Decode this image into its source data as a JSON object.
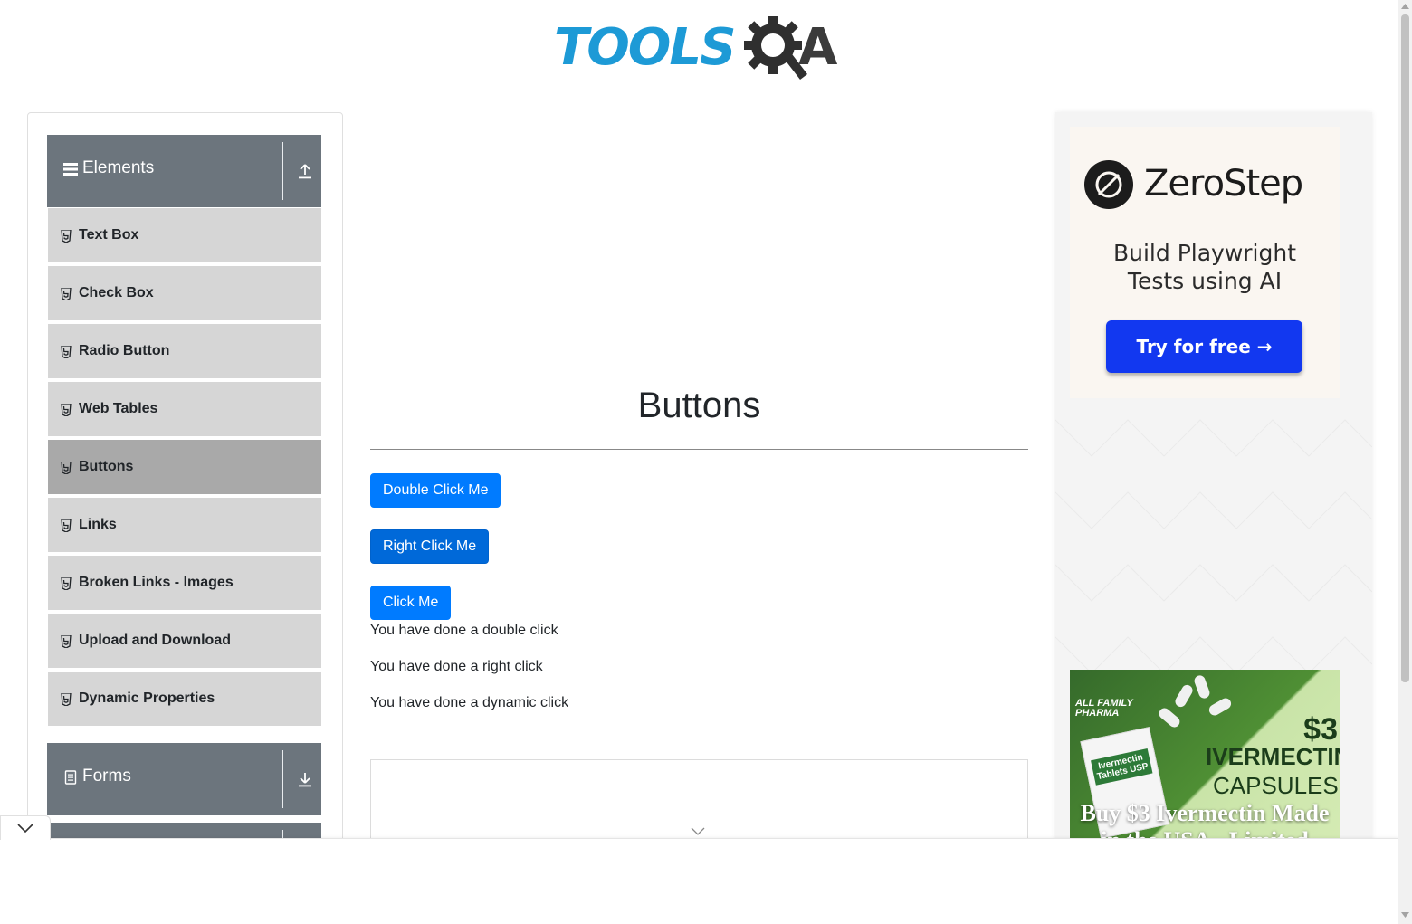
{
  "header": {
    "logo_text": "TOOLS",
    "logo_suffix": "A"
  },
  "sidebar": {
    "groups": [
      {
        "title": "Elements",
        "icon": "hamburger-icon",
        "arrow": "expand-up-icon"
      },
      {
        "title": "Forms",
        "icon": "document-icon",
        "arrow": "expand-down-icon"
      }
    ],
    "items": [
      {
        "label": "Text Box"
      },
      {
        "label": "Check Box"
      },
      {
        "label": "Radio Button"
      },
      {
        "label": "Web Tables"
      },
      {
        "label": "Buttons",
        "active": true
      },
      {
        "label": "Links"
      },
      {
        "label": "Broken Links - Images"
      },
      {
        "label": "Upload and Download"
      },
      {
        "label": "Dynamic Properties"
      }
    ]
  },
  "main": {
    "title": "Buttons",
    "buttons": {
      "double_click": "Double Click Me",
      "right_click": "Right Click Me",
      "click": "Click Me"
    },
    "messages": {
      "double": "You have done a double click",
      "right": "You have done a right click",
      "dynamic": "You have done a dynamic click"
    }
  },
  "ads": {
    "zerostep": {
      "brand": "ZeroStep",
      "tagline_line1": "Build Playwright",
      "tagline_line2": "Tests using AI",
      "cta": "Try for free →",
      "colors": {
        "cta": "#1238f0",
        "background": "#faf6f1"
      }
    },
    "pharma": {
      "brand_line1": "ALL FAMILY",
      "brand_line2": "PHARMA",
      "box_label_line1": "Ivermectin",
      "box_label_line2": "Tablets USP",
      "price": "$3",
      "word1": "IVERMECTIN",
      "word2": "CAPSULES",
      "headline_line1": "Buy $3 Ivermectin Made",
      "headline_line2": "in the USA - Limited"
    }
  },
  "colors": {
    "primary_button": "#007bff",
    "sidebar_header": "#6c757d",
    "menu_item": "#d6d6d6",
    "menu_item_active": "#a9a9a9",
    "logo_blue": "#1d9ad6"
  }
}
